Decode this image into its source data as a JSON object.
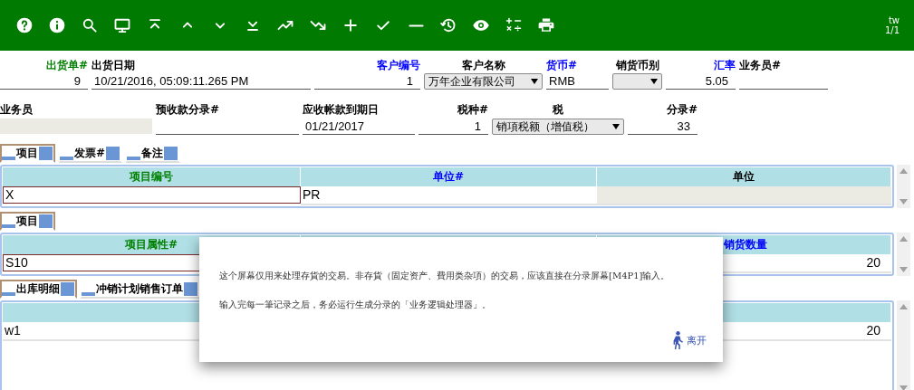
{
  "toolbar": {
    "user": "tw",
    "page": "1/1"
  },
  "form_rows": [
    [
      {
        "label": "出货单#",
        "color": "#008000",
        "kind": "number",
        "value": "9"
      },
      {
        "label": "出货日期",
        "color": "#000000",
        "kind": "text",
        "value": "10/21/2016, 05:09:11.265 PM"
      },
      {
        "label": "客户编号",
        "color": "#0000ff",
        "kind": "number",
        "value": "1"
      },
      {
        "label": "客户名称",
        "color": "#000000",
        "kind": "select",
        "value": "万年企业有限公司"
      },
      {
        "label": "货币#",
        "color": "#0000ff",
        "kind": "text",
        "value": "RMB"
      },
      {
        "label": "销货币别",
        "color": "#000000",
        "kind": "select"
      },
      {
        "label": "汇率",
        "color": "#0000ff",
        "kind": "number",
        "value": "5.05"
      },
      {
        "label": "业务员#",
        "color": "#000000",
        "kind": "text"
      }
    ],
    [
      {
        "label": "业务员",
        "color": "#000000",
        "kind": "disabled"
      },
      {
        "label": "预收款分录#",
        "color": "#000000",
        "kind": "text"
      },
      {
        "label": "应收帐款到期日",
        "color": "#000000",
        "kind": "text",
        "value": "01/21/2017"
      },
      {
        "label": "税种#",
        "color": "#000000",
        "kind": "number",
        "value": "1"
      },
      {
        "label": "税",
        "color": "#000000",
        "kind": "select",
        "value": "销項税额（增值税）"
      },
      {
        "label": "分录#",
        "color": "#000000",
        "kind": "number",
        "value": "33"
      }
    ]
  ],
  "sections": [
    {
      "tabs": [
        {
          "label": "项目",
          "selected": true
        },
        {
          "label": "发票#",
          "selected": false
        },
        {
          "label": "备注",
          "selected": false
        }
      ],
      "columns": {
        "column_1": {
          "label": "项目编号",
          "color": "#008000"
        },
        "column_2": {
          "label": "单位#",
          "color": "#0000ff"
        },
        "column_3": {
          "label": "单位",
          "color": "#000000"
        }
      },
      "row": {
        "column_1": {
          "text": "X",
          "kind": "input"
        },
        "column_2": {
          "text": "PR",
          "kind": "text"
        },
        "column_3": {
          "kind": "disabled"
        }
      }
    },
    {
      "tabs": [
        {
          "label": "项目",
          "selected": true
        }
      ],
      "columns": {
        "column_1": {
          "label": "项目属性#",
          "color": "#008000"
        },
        "column_3": {
          "label": "销货数量",
          "color": "#0000ff"
        }
      },
      "row": {
        "column_1": {
          "text": "S10",
          "kind": "input"
        },
        "column_3": {
          "text": "20",
          "kind": "number"
        }
      }
    },
    {
      "tabs": [
        {
          "label": "出库明细",
          "selected": true
        },
        {
          "label": "冲销计划销售订单",
          "selected": false
        }
      ],
      "row": {
        "column_1": {
          "text": "w1",
          "kind": "text"
        },
        "column_3": {
          "text": "20",
          "kind": "number"
        }
      }
    }
  ],
  "dialog": {
    "paragraphs": [
      "这个屏幕仅用来处理存貨的交易。非存貨（固定资产、費用类杂項）的交易，应该直接在分录屏幕[M4P1]输入。",
      "输入完每一筆记录之后，务必运行生成分录的「业务逻辑处理器」。"
    ],
    "exit_button": "离开"
  }
}
